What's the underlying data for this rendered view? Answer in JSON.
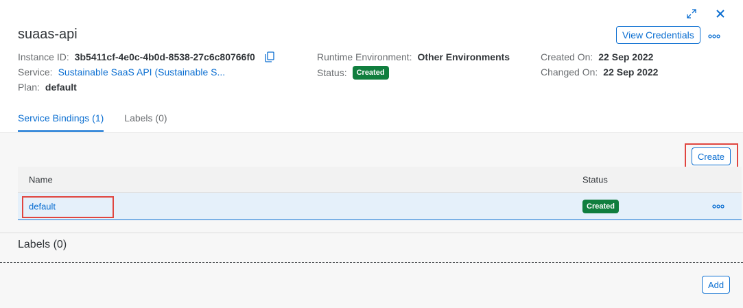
{
  "header": {
    "title": "suaas-api",
    "view_credentials_label": "View Credentials",
    "icons": {
      "expand": "expand-icon",
      "close": "close-icon",
      "more": "more-icon",
      "copy": "copy-icon"
    }
  },
  "meta": {
    "instance_id_label": "Instance ID:",
    "instance_id_value": "3b5411cf-4e0c-4b0d-8538-27c6c80766f0",
    "service_label": "Service:",
    "service_value": "Sustainable SaaS API (Sustainable S...",
    "plan_label": "Plan:",
    "plan_value": "default",
    "runtime_label": "Runtime Environment:",
    "runtime_value": "Other Environments",
    "status_label": "Status:",
    "status_value": "Created",
    "created_label": "Created On:",
    "created_value": "22 Sep 2022",
    "changed_label": "Changed On:",
    "changed_value": "22 Sep 2022"
  },
  "tabs": [
    {
      "label": "Service Bindings (1)",
      "active": true
    },
    {
      "label": "Labels (0)",
      "active": false
    }
  ],
  "bindings": {
    "create_label": "Create",
    "columns": {
      "name": "Name",
      "status": "Status"
    },
    "rows": [
      {
        "name": "default",
        "status": "Created"
      }
    ]
  },
  "labels_section": {
    "title": "Labels (0)",
    "add_label": "Add"
  },
  "colors": {
    "accent": "#0a6ed1",
    "success": "#107e3e",
    "highlight": "#e0453f"
  }
}
